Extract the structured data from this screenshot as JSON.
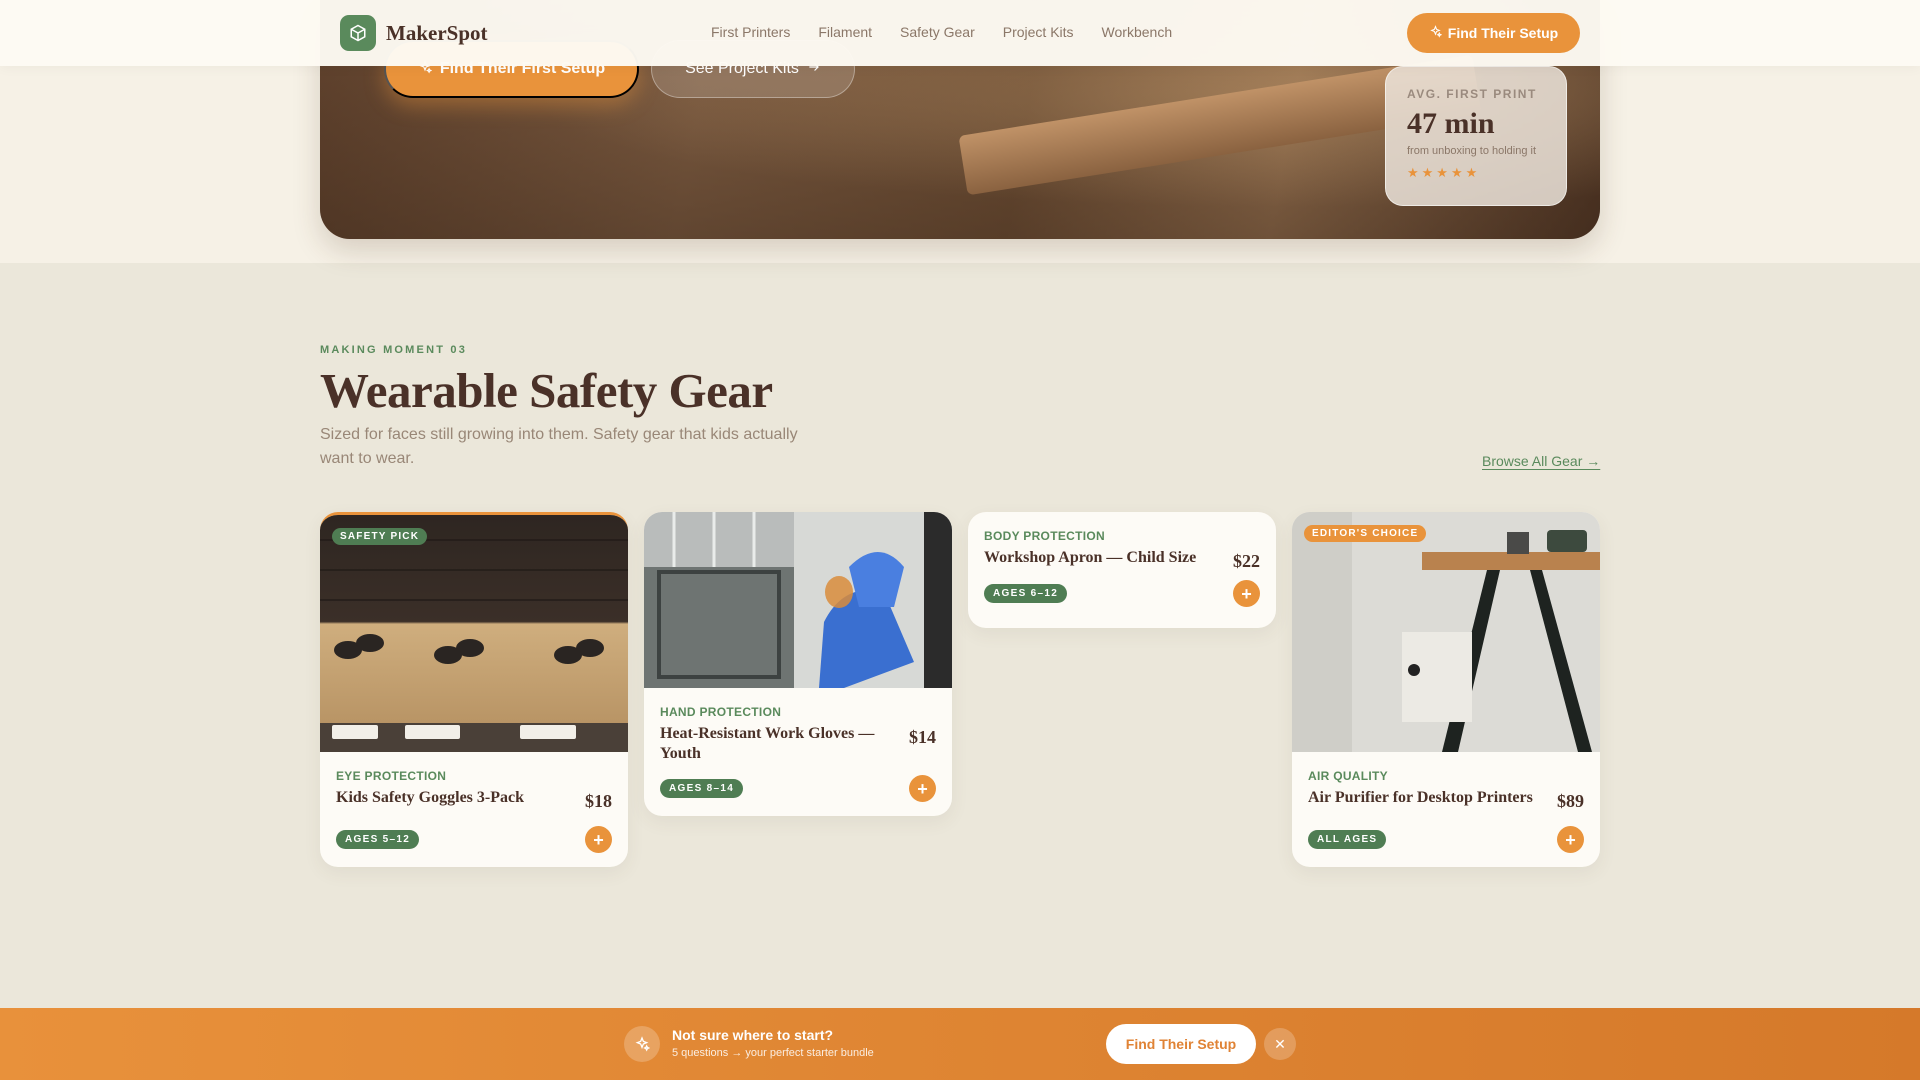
{
  "nav": {
    "brand": "MakerSpot",
    "links": [
      "First Printers",
      "Filament",
      "Safety Gear",
      "Project Kits",
      "Workbench"
    ],
    "cta": "Find Their Setup"
  },
  "hero": {
    "primary_cta": "Find Their First Setup",
    "secondary_cta": "See Project Kits",
    "stat": {
      "label": "AVG. FIRST PRINT",
      "value": "47 min",
      "sub": "from unboxing to holding it",
      "rating": 5,
      "stars": "★★★★★"
    }
  },
  "section": {
    "eyebrow": "MAKING MOMENT 03",
    "title": "Wearable Safety Gear",
    "description": "Sized for faces still growing into them. Safety gear that kids actually want to wear.",
    "browse_link": "Browse All Gear →"
  },
  "products": [
    {
      "badge": "SAFETY PICK",
      "category": "EYE PROTECTION",
      "name": "Kids Safety Goggles 3-Pack",
      "price": "$18",
      "age": "AGES 5–12"
    },
    {
      "category": "HAND PROTECTION",
      "name": "Heat-Resistant Work Gloves — Youth",
      "price": "$14",
      "age": "AGES 8–14"
    },
    {
      "category": "BODY PROTECTION",
      "name": "Workshop Apron — Child Size",
      "price": "$22",
      "age": "AGES 6–12"
    },
    {
      "badge": "EDITOR'S CHOICE",
      "category": "AIR QUALITY",
      "name": "Air Purifier for Desktop Printers",
      "price": "$89",
      "age": "ALL AGES"
    }
  ],
  "add_label": "+",
  "bottom_bar": {
    "title": "Not sure where to start?",
    "subtitle": "5 questions → your perfect starter bundle",
    "cta": "Find Their Setup",
    "close": "✕"
  },
  "colors": {
    "accent": "#e9933b",
    "brand_green": "#5a8a5c",
    "text_dark": "#4a3128",
    "background": "#ebe7da"
  }
}
